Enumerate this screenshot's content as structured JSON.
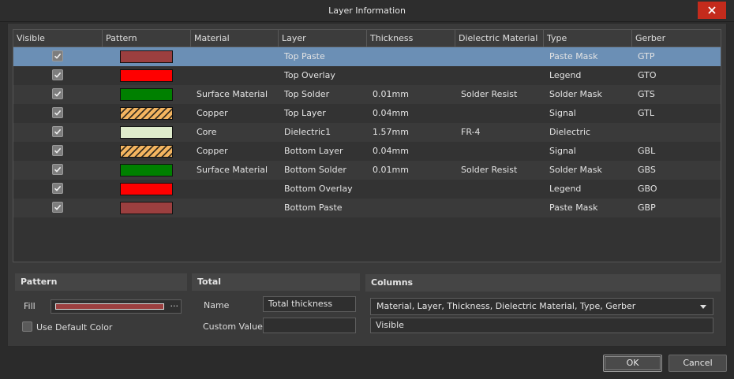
{
  "window": {
    "title": "Layer Information",
    "close_icon": "close-icon"
  },
  "table": {
    "columns": [
      "Visible",
      "Pattern",
      "Material",
      "Layer",
      "Thickness",
      "Dielectric Material",
      "Type",
      "Gerber"
    ],
    "rows": [
      {
        "visible": true,
        "pattern_color": "#9b3f3f",
        "hatched": false,
        "material": "",
        "layer": "Top Paste",
        "thickness": "",
        "dielectric": "",
        "type": "Paste Mask",
        "gerber": "GTP",
        "selected": true
      },
      {
        "visible": true,
        "pattern_color": "#ff0000",
        "hatched": false,
        "material": "",
        "layer": "Top Overlay",
        "thickness": "",
        "dielectric": "",
        "type": "Legend",
        "gerber": "GTO"
      },
      {
        "visible": true,
        "pattern_color": "#008000",
        "hatched": false,
        "material": "Surface Material",
        "layer": "Top Solder",
        "thickness": "0.01mm",
        "dielectric": "Solder Resist",
        "type": "Solder Mask",
        "gerber": "GTS"
      },
      {
        "visible": true,
        "pattern_color": "#f4b560",
        "hatched": true,
        "material": "Copper",
        "layer": "Top Layer",
        "thickness": "0.04mm",
        "dielectric": "",
        "type": "Signal",
        "gerber": "GTL"
      },
      {
        "visible": true,
        "pattern_color": "#dfeccc",
        "hatched": false,
        "material": "Core",
        "layer": "Dielectric1",
        "thickness": "1.57mm",
        "dielectric": "FR-4",
        "type": "Dielectric",
        "gerber": ""
      },
      {
        "visible": true,
        "pattern_color": "#f4b560",
        "hatched": true,
        "material": "Copper",
        "layer": "Bottom Layer",
        "thickness": "0.04mm",
        "dielectric": "",
        "type": "Signal",
        "gerber": "GBL"
      },
      {
        "visible": true,
        "pattern_color": "#008000",
        "hatched": false,
        "material": "Surface Material",
        "layer": "Bottom Solder",
        "thickness": "0.01mm",
        "dielectric": "Solder Resist",
        "type": "Solder Mask",
        "gerber": "GBS"
      },
      {
        "visible": true,
        "pattern_color": "#ff0000",
        "hatched": false,
        "material": "",
        "layer": "Bottom Overlay",
        "thickness": "",
        "dielectric": "",
        "type": "Legend",
        "gerber": "GBO"
      },
      {
        "visible": true,
        "pattern_color": "#9b3f3f",
        "hatched": false,
        "material": "",
        "layer": "Bottom Paste",
        "thickness": "",
        "dielectric": "",
        "type": "Paste Mask",
        "gerber": "GBP"
      }
    ]
  },
  "pattern_panel": {
    "heading": "Pattern",
    "fill_label": "Fill",
    "fill_color": "#9b3f3f",
    "ellipsis": "···",
    "use_default_label": "Use Default Color",
    "use_default_checked": false
  },
  "total_panel": {
    "heading": "Total",
    "name_label": "Name",
    "name_value": "Total thickness",
    "custom_label": "Custom Value",
    "custom_value": ""
  },
  "columns_panel": {
    "heading": "Columns",
    "selected": "Material, Layer, Thickness, Dielectric Material, Type, Gerber",
    "second": "Visible"
  },
  "buttons": {
    "ok": "OK",
    "cancel": "Cancel"
  }
}
